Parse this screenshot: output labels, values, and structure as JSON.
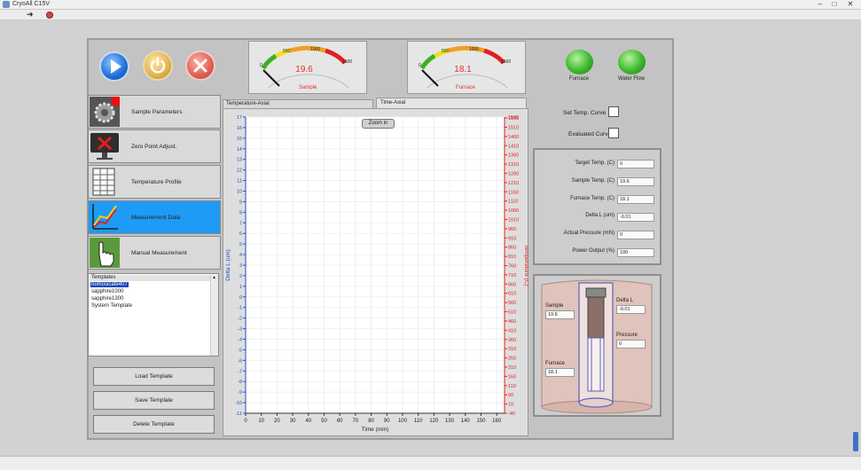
{
  "window": {
    "title": "CryoAll C15V",
    "controls": [
      "–",
      "□",
      "✕"
    ]
  },
  "colors": {
    "accent_active": "#1e9bf5",
    "gauge_value": "#e03030",
    "axis_left": "#2050c0",
    "axis_right": "#e02020",
    "led_on": "#3cb82e"
  },
  "gauges": {
    "sample": {
      "label": "Sample",
      "value": "19.6",
      "ticks": [
        "0",
        "500",
        "1000",
        "1500"
      ]
    },
    "furnace": {
      "label": "Furnace",
      "value": "18.1",
      "ticks": [
        "0",
        "500",
        "1000",
        "1500"
      ]
    }
  },
  "leds": {
    "furnace": "Furnace",
    "water_flow": "Water Flow"
  },
  "nav": [
    {
      "label": "Sample Parameters",
      "icon": "gear-icon"
    },
    {
      "label": "Zero Point Adjust.",
      "icon": "zero-point-icon"
    },
    {
      "label": "Temperature Profile",
      "icon": "table-icon"
    },
    {
      "label": "Measurement Data",
      "icon": "graph-icon"
    },
    {
      "label": "Manual Measurement",
      "icon": "hand-pointer-icon"
    }
  ],
  "templates": {
    "header": "Templates",
    "items": [
      "homosicate407",
      "sapphire1000",
      "sapphire1300",
      "System Template"
    ],
    "selected_index": 0
  },
  "template_buttons": {
    "load": "Load Template",
    "save": "Save Template",
    "delete": "Delete Template"
  },
  "tabs": {
    "temperature_axial": "Temperature-Axial",
    "time_axial": "Time-Axial"
  },
  "zoom_label": "Zoom in",
  "chart_data": {
    "type": "line",
    "xlabel": "Time (min)",
    "ylabel_left": "Delta L (um)",
    "ylabel_right": "Temperature (C)",
    "xlim": [
      0,
      165
    ],
    "x_ticks": [
      0,
      10,
      20,
      30,
      40,
      50,
      60,
      70,
      80,
      90,
      100,
      110,
      120,
      130,
      140,
      150,
      160
    ],
    "ylim_left": [
      -11,
      17
    ],
    "ylim_right": [
      -40,
      1565
    ],
    "grid": true,
    "series": []
  },
  "checkboxes": {
    "set_temp_curve": "Set Temp. Curve",
    "evaluated_curve": "Evaluated Curve"
  },
  "readings": [
    {
      "label": "Target Temp. (C)",
      "value": "0"
    },
    {
      "label": "Sample Temp. (C)",
      "value": "19.6"
    },
    {
      "label": "Furnace Temp. (C)",
      "value": "18.1"
    },
    {
      "label": "Delta L (um)",
      "value": "-0.01"
    },
    {
      "label": "Actual Pressure (mN)",
      "value": "0"
    },
    {
      "label": "Power Output (%)",
      "value": "100"
    }
  ],
  "schematic": {
    "sample_label": "Sample",
    "sample_value": "19.6",
    "delta_label": "Delta L",
    "delta_value": "-0.01",
    "pressure_label": "Pressure",
    "pressure_value": "0",
    "furnace_label": "Furnace",
    "furnace_value": "18.1"
  }
}
